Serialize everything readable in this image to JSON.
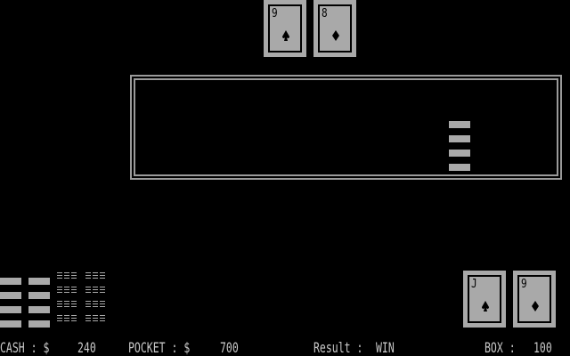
{
  "dealer_cards": [
    {
      "rank": "9",
      "suit": "spades"
    },
    {
      "rank": "8",
      "suit": "diamonds"
    }
  ],
  "player_cards": [
    {
      "rank": "J",
      "suit": "spades"
    },
    {
      "rank": "9",
      "suit": "diamonds"
    }
  ],
  "status": {
    "cash_label": "CASH : $",
    "cash_value": "240",
    "pocket_label": "POCKET : $",
    "pocket_value": "700",
    "result_label": "Result :",
    "result_value": "WIN",
    "box_label": "BOX :",
    "box_value": "100"
  },
  "colors": {
    "background": "#000000",
    "card": "#a9a9a9",
    "text": "#c8c8c8",
    "border": "#9a9a9a"
  }
}
